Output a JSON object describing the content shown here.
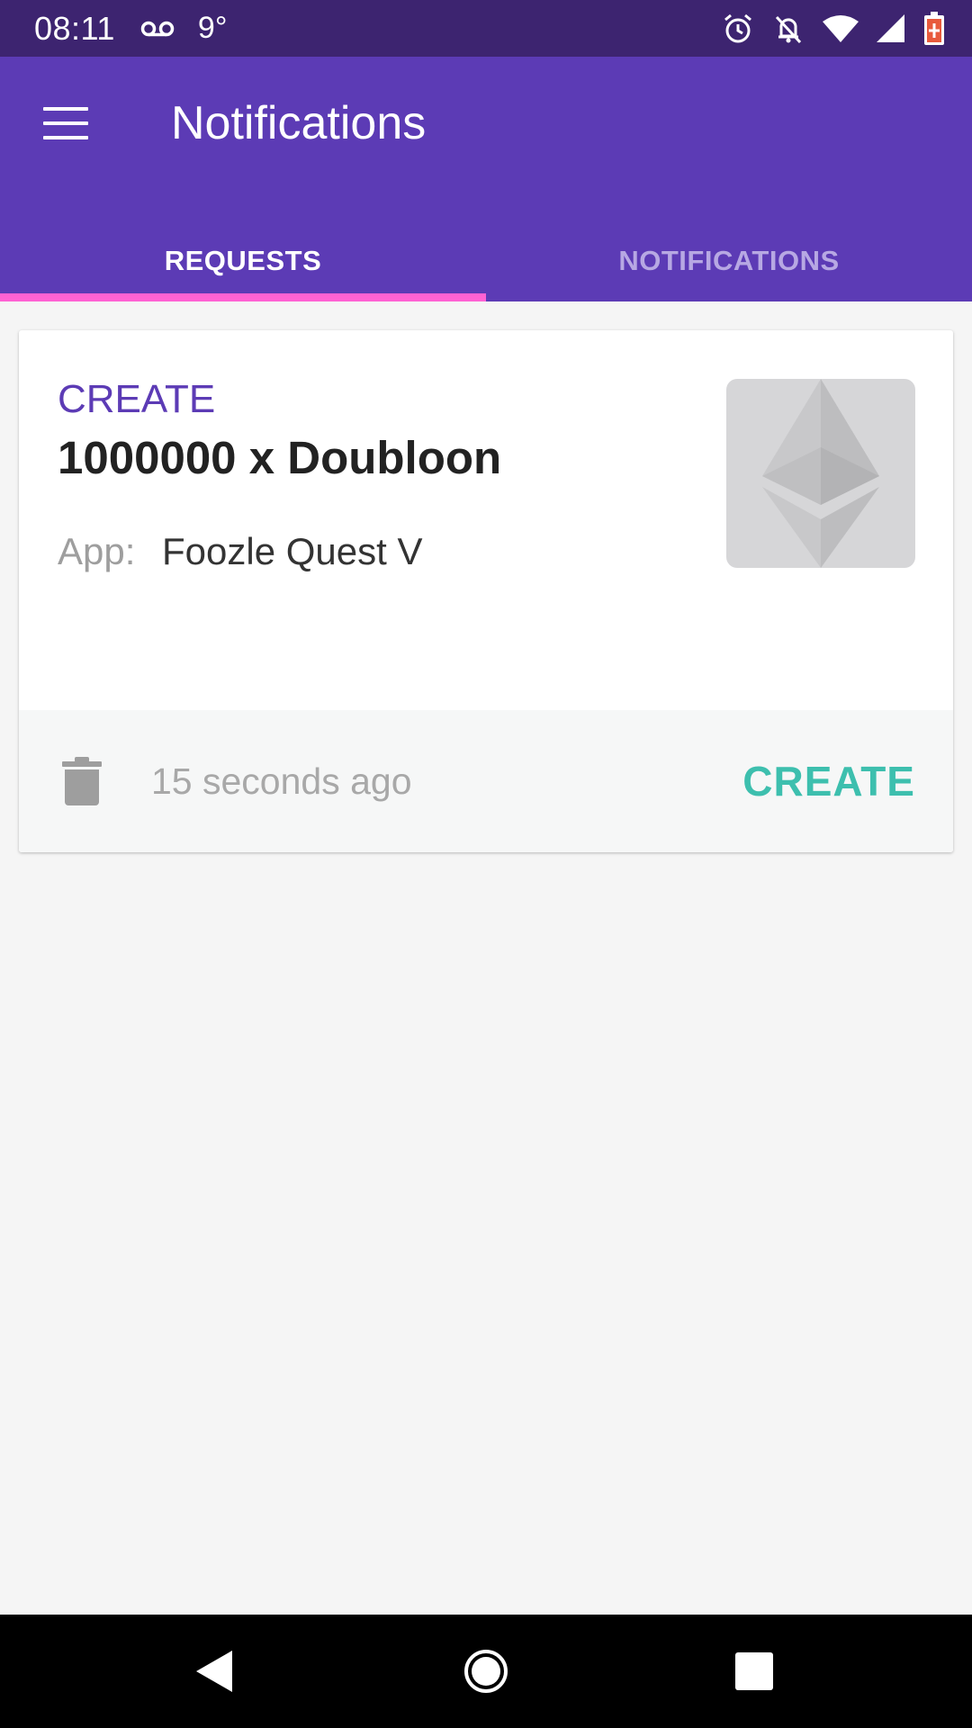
{
  "status_bar": {
    "time": "08:11",
    "temperature": "9°",
    "icons": [
      "voicemail-icon",
      "alarm-icon",
      "notifications-off-icon",
      "wifi-icon",
      "cell-signal-icon",
      "battery-charging-icon"
    ]
  },
  "app_bar": {
    "title": "Notifications",
    "menu_icon": "hamburger-menu-icon",
    "background_color": "#5c3bb5"
  },
  "tabs": [
    {
      "label": "REQUESTS",
      "active": true
    },
    {
      "label": "NOTIFICATIONS",
      "active": false
    }
  ],
  "tab_indicator_color": "#ff62d3",
  "request_card": {
    "type_label": "CREATE",
    "title": "1000000 x Doubloon",
    "app_label": "App:",
    "app_name": "Foozle Quest V",
    "thumbnail_icon": "ethereum-icon",
    "time_ago": "15 seconds ago",
    "delete_icon": "trash-icon",
    "action_label": "CREATE",
    "action_color": "#3dbfae"
  },
  "nav_bar": {
    "icons": [
      "back-icon",
      "home-icon",
      "recents-icon"
    ]
  }
}
